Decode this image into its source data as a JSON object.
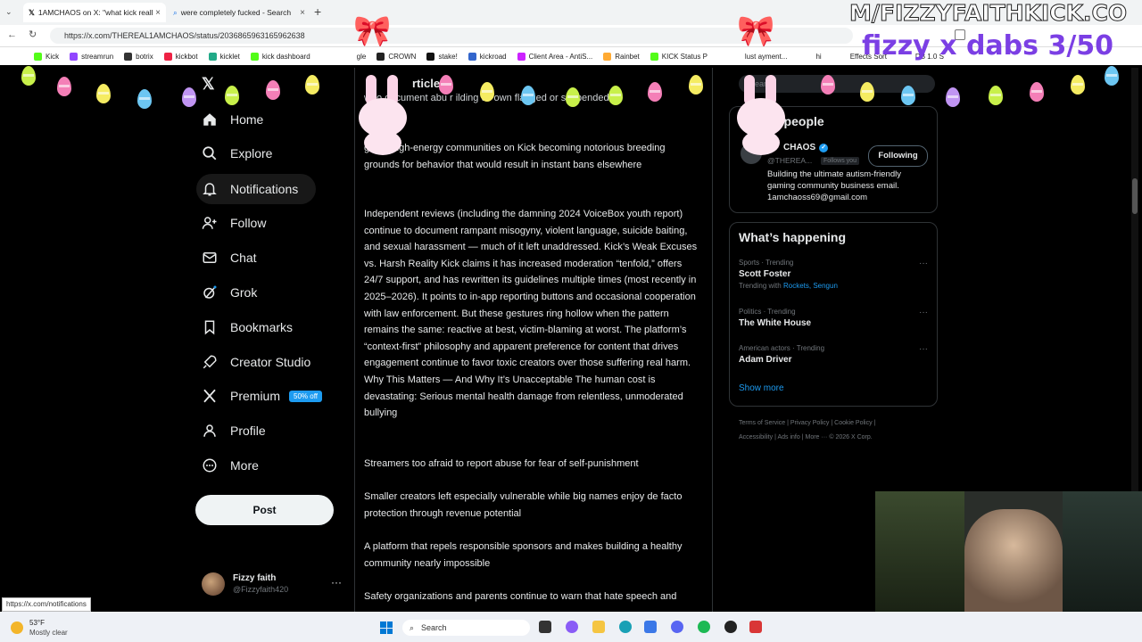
{
  "browser": {
    "tabs": [
      {
        "label": "1AMCHAOS on X: \"what kick reall",
        "active": true
      },
      {
        "label": "were completely fucked - Search",
        "active": false
      }
    ],
    "url": "https://x.com/THEREAL1AMCHAOS/status/2036865963165962638",
    "bookmarks": [
      "Kick",
      "streamrun",
      "botrix",
      "kickbot",
      "kicklet",
      "kick dashboard",
      "gle",
      "CROWN",
      "stake!",
      "kickroad",
      "Client Area - AntiS...",
      "Rainbet",
      "KICK Status P",
      "lust ayment...",
      "hi",
      "Effects Sort",
      "DB 1.0 S"
    ]
  },
  "overlay": {
    "title": "M/FIZZYFAITHKICK.CO",
    "subtitle": "fizzy x dabs 3/50"
  },
  "sidebar": {
    "items": [
      {
        "label": "Home",
        "icon": "home-icon"
      },
      {
        "label": "Explore",
        "icon": "search-icon"
      },
      {
        "label": "Notifications",
        "icon": "bell-icon"
      },
      {
        "label": "Follow",
        "icon": "person-add-icon"
      },
      {
        "label": "Chat",
        "icon": "mail-icon"
      },
      {
        "label": "Grok",
        "icon": "grok-icon"
      },
      {
        "label": "Bookmarks",
        "icon": "bookmark-icon"
      },
      {
        "label": "Creator Studio",
        "icon": "rocket-icon"
      },
      {
        "label": "Premium",
        "icon": "x-icon"
      },
      {
        "label": "Profile",
        "icon": "profile-icon"
      },
      {
        "label": "More",
        "icon": "more-icon"
      }
    ],
    "premium_badge": "50% off",
    "post_label": "Post",
    "account": {
      "name": "Fizzy faith",
      "handle": "@Fizzyfaith420"
    }
  },
  "article": {
    "header": "rticle",
    "paragraphs": [
      "who document abu r ilding ull own flagged or suspended",
      "g and high-energy communities on Kick becoming notorious breeding grounds for behavior that would result in instant bans elsewhere",
      "Independent reviews (including the damning 2024 VoiceBox youth report) continue to document rampant misogyny, violent language, suicide baiting, and sexual harassment — much of it left unaddressed. Kick’s Weak Excuses vs. Harsh Reality Kick claims it has increased moderation “tenfold,” offers 24/7 support, and has rewritten its guidelines multiple times (most recently in 2025–2026). It points to in-app reporting buttons and occasional cooperation with law enforcement. But these gestures ring hollow when the pattern remains the same: reactive at best, victim-blaming at worst. The platform’s “context-first” philosophy and apparent preference for content that drives engagement continue to favor toxic creators over those suffering real harm. Why This Matters — And Why It’s Unacceptable The human cost is devastating: Serious mental health damage from relentless, unmoderated bullying",
      "Streamers too afraid to report abuse for fear of self-punishment",
      "Smaller creators left especially vulnerable while big names enjoy de facto protection through revenue potential",
      "A platform that repels responsible sponsors and makes building a healthy community nearly impossible",
      "Safety organizations and parents continue to warn that hate speech and"
    ]
  },
  "right": {
    "search_placeholder": "Search",
    "relevant": {
      "title": "t people",
      "name": "CHAOS",
      "handle": "@THEREA...",
      "follows_you": "Follows you",
      "following_label": "Following",
      "bio": "Building the ultimate autism-friendly gaming community business email. 1amchaoss69@gmail.com"
    },
    "happening_title": "What’s happening",
    "trends": [
      {
        "category": "Sports · Trending",
        "title": "Scott Foster",
        "extra_prefix": "Trending with",
        "extra": "Rockets, Sengun"
      },
      {
        "category": "Politics · Trending",
        "title": "The White House",
        "extra_prefix": "",
        "extra": ""
      },
      {
        "category": "American actors · Trending",
        "title": "Adam Driver",
        "extra_prefix": "",
        "extra": ""
      }
    ],
    "show_more": "Show more",
    "footer": [
      "Terms of Service",
      "|",
      "Privacy Policy",
      "|",
      "Cookie Policy",
      "|",
      "Accessibility",
      "|",
      "Ads info",
      "|",
      "More ···",
      "© 2026 X Corp."
    ]
  },
  "status_url": "https://x.com/notifications",
  "taskbar": {
    "weather_temp": "53°F",
    "weather_desc": "Mostly clear",
    "search_label": "Search"
  },
  "colors": {
    "accent": "#1d9bf0",
    "background": "#000000",
    "overlay_purple": "#7b3fe4"
  }
}
